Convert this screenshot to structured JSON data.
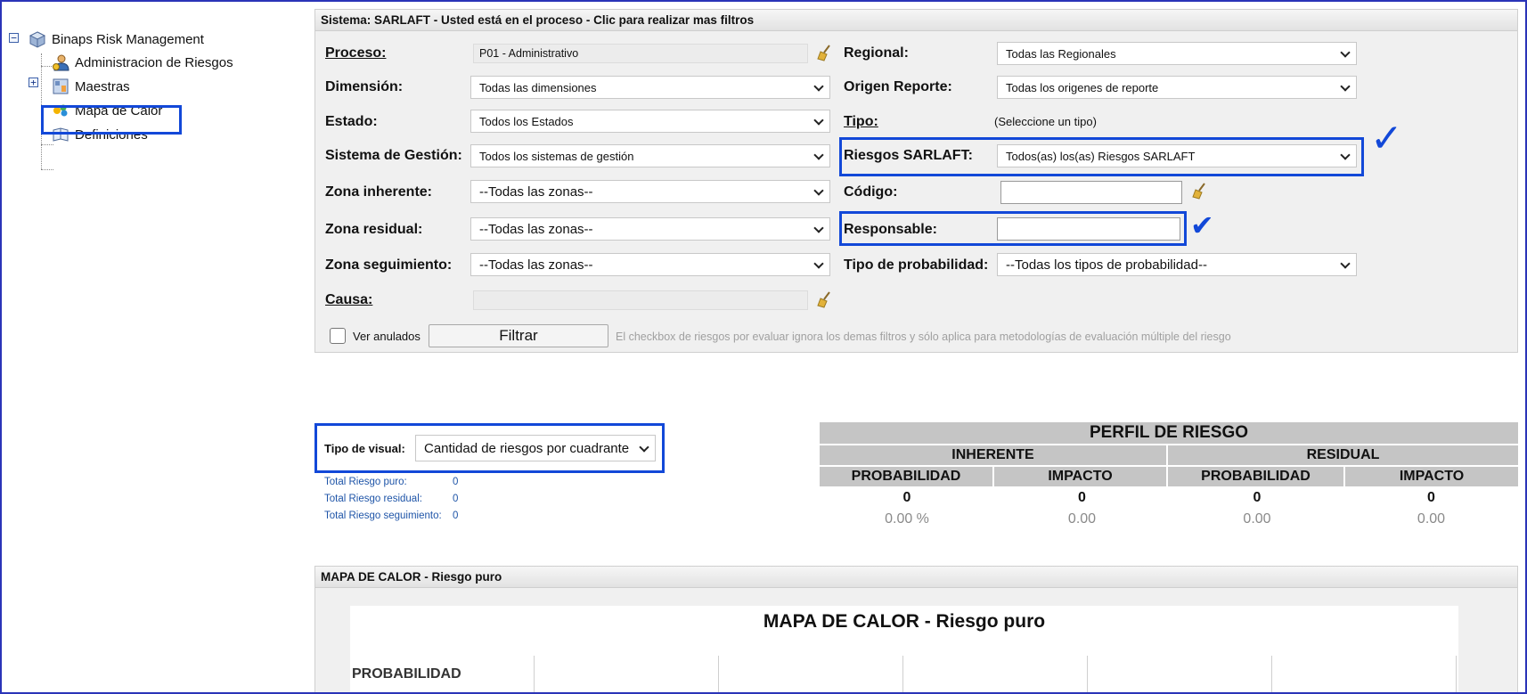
{
  "tree": {
    "root": "Binaps Risk Management",
    "items": [
      "Administracion de Riesgos",
      "Maestras",
      "Mapa de Calor",
      "Definiciones"
    ]
  },
  "filters": {
    "header": "Sistema: SARLAFT - Usted está en el proceso - Clic para realizar mas filtros",
    "proceso_label": "Proceso:",
    "proceso_value": "P01 - Administrativo",
    "dimension_label": "Dimensión:",
    "dimension_value": "Todas las dimensiones",
    "estado_label": "Estado:",
    "estado_value": "Todos los Estados",
    "sistema_label": "Sistema de Gestión:",
    "sistema_value": "Todos los sistemas de gestión",
    "zona_inh_label": "Zona inherente:",
    "zona_inh_value": "--Todas las zonas--",
    "zona_res_label": "Zona residual:",
    "zona_res_value": "--Todas las zonas--",
    "zona_seg_label": "Zona seguimiento:",
    "zona_seg_value": "--Todas las zonas--",
    "causa_label": "Causa:",
    "regional_label": "Regional:",
    "regional_value": "Todas las Regionales",
    "origen_label": "Origen Reporte:",
    "origen_value": "Todas los origenes de reporte",
    "tipo_label": "Tipo:",
    "tipo_value": "(Seleccione un tipo)",
    "riesgos_label": "Riesgos SARLAFT:",
    "riesgos_value": "Todos(as) los(as) Riesgos SARLAFT",
    "codigo_label": "Código:",
    "responsable_label": "Responsable:",
    "tipo_prob_label": "Tipo de probabilidad:",
    "tipo_prob_value": "--Todas los tipos de probabilidad--",
    "ver_anulados": "Ver anulados",
    "filtrar": "Filtrar",
    "note": "El checkbox de riesgos por evaluar ignora los demas filtros y sólo aplica para metodologías de evaluación múltiple del riesgo"
  },
  "visual": {
    "label": "Tipo de visual:",
    "value": "Cantidad de riesgos por cuadrante"
  },
  "totals": [
    {
      "label": "Total Riesgo puro:",
      "value": "0"
    },
    {
      "label": "Total Riesgo residual:",
      "value": "0"
    },
    {
      "label": "Total Riesgo seguimiento:",
      "value": "0"
    }
  ],
  "perfil": {
    "title": "PERFIL DE RIESGO",
    "inherente": "INHERENTE",
    "residual": "RESIDUAL",
    "probabilidad": "PROBABILIDAD",
    "impacto": "IMPACTO",
    "values": [
      "0",
      "0",
      "0",
      "0"
    ],
    "pcts": [
      "0.00 %",
      "0.00",
      "0.00",
      "0.00"
    ]
  },
  "mapa": {
    "header": "MAPA DE CALOR - Riesgo puro",
    "title": "MAPA DE CALOR - Riesgo puro",
    "axis": "PROBABILIDAD"
  },
  "checkmarks": [
    "✓",
    "✔"
  ],
  "colors": {
    "highlight": "#1248d8",
    "panel": "#f0f0f0",
    "header_gray": "#c5c5c5"
  }
}
